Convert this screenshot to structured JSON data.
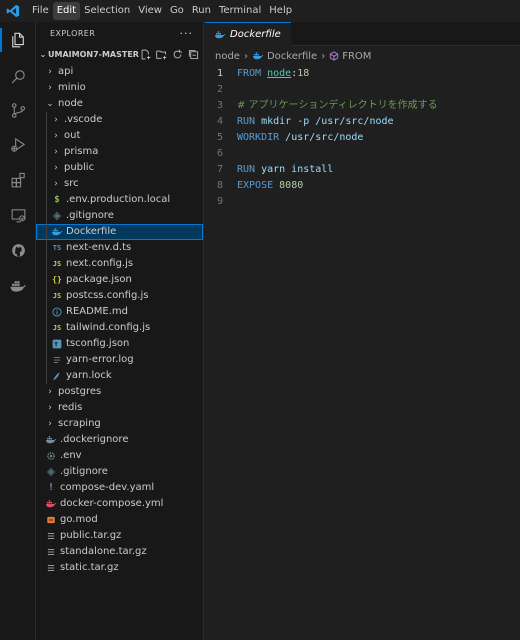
{
  "menu": [
    "File",
    "Edit",
    "Selection",
    "View",
    "Go",
    "Run",
    "Terminal",
    "Help"
  ],
  "activity_bar": [
    "files-icon",
    "search-icon",
    "source-control-icon",
    "run-debug-icon",
    "extensions-icon",
    "remote-explorer-icon",
    "github-icon",
    "docker-icon"
  ],
  "sidebar": {
    "title": "EXPLORER",
    "more": "···",
    "workspace": "UMAIMON7-MASTER",
    "tree": [
      {
        "label": "api",
        "kind": "folder",
        "depth": 1,
        "expanded": false
      },
      {
        "label": "minio",
        "kind": "folder",
        "depth": 1,
        "expanded": false
      },
      {
        "label": "node",
        "kind": "folder",
        "depth": 1,
        "expanded": true
      },
      {
        "label": ".vscode",
        "kind": "folder",
        "depth": 2,
        "expanded": false
      },
      {
        "label": "out",
        "kind": "folder",
        "depth": 2,
        "expanded": false
      },
      {
        "label": "prisma",
        "kind": "folder",
        "depth": 2,
        "expanded": false
      },
      {
        "label": "public",
        "kind": "folder",
        "depth": 2,
        "expanded": false
      },
      {
        "label": "src",
        "kind": "folder",
        "depth": 2,
        "expanded": false
      },
      {
        "label": ".env.production.local",
        "kind": "file",
        "icon": "dollar",
        "depth": 2
      },
      {
        "label": ".gitignore",
        "kind": "file",
        "icon": "git",
        "depth": 2
      },
      {
        "label": "Dockerfile",
        "kind": "file",
        "icon": "docker",
        "depth": 2,
        "selected": true
      },
      {
        "label": "next-env.d.ts",
        "kind": "file",
        "icon": "ts",
        "depth": 2
      },
      {
        "label": "next.config.js",
        "kind": "file",
        "icon": "js",
        "depth": 2
      },
      {
        "label": "package.json",
        "kind": "file",
        "icon": "json",
        "depth": 2
      },
      {
        "label": "postcss.config.js",
        "kind": "file",
        "icon": "js",
        "depth": 2
      },
      {
        "label": "README.md",
        "kind": "file",
        "icon": "info",
        "depth": 2
      },
      {
        "label": "tailwind.config.js",
        "kind": "file",
        "icon": "js",
        "depth": 2
      },
      {
        "label": "tsconfig.json",
        "kind": "file",
        "icon": "tsconfig",
        "depth": 2
      },
      {
        "label": "yarn-error.log",
        "kind": "file",
        "icon": "log",
        "depth": 2
      },
      {
        "label": "yarn.lock",
        "kind": "file",
        "icon": "yarn",
        "depth": 2
      },
      {
        "label": "postgres",
        "kind": "folder",
        "depth": 1,
        "expanded": false
      },
      {
        "label": "redis",
        "kind": "folder",
        "depth": 1,
        "expanded": false
      },
      {
        "label": "scraping",
        "kind": "folder",
        "depth": 1,
        "expanded": false
      },
      {
        "label": ".dockerignore",
        "kind": "file",
        "icon": "docker-gray",
        "depth": 1
      },
      {
        "label": ".env",
        "kind": "file",
        "icon": "gear",
        "depth": 1
      },
      {
        "label": ".gitignore",
        "kind": "file",
        "icon": "git",
        "depth": 1
      },
      {
        "label": "compose-dev.yaml",
        "kind": "file",
        "icon": "yaml",
        "depth": 1
      },
      {
        "label": "docker-compose.yml",
        "kind": "file",
        "icon": "docker-compose",
        "depth": 1
      },
      {
        "label": "go.mod",
        "kind": "file",
        "icon": "gomod",
        "depth": 1
      },
      {
        "label": "public.tar.gz",
        "kind": "file",
        "icon": "lines",
        "depth": 1
      },
      {
        "label": "standalone.tar.gz",
        "kind": "file",
        "icon": "lines",
        "depth": 1
      },
      {
        "label": "static.tar.gz",
        "kind": "file",
        "icon": "lines",
        "depth": 1
      }
    ]
  },
  "editor": {
    "tab_label": "Dockerfile",
    "breadcrumb": [
      "node",
      "Dockerfile",
      "FROM"
    ],
    "lines": [
      {
        "n": "1",
        "tokens": [
          {
            "t": "FROM",
            "c": "kw"
          },
          {
            "t": " "
          },
          {
            "t": "node",
            "c": "ident tok-u"
          },
          {
            "t": ":"
          },
          {
            "t": "18",
            "c": "num"
          }
        ]
      },
      {
        "n": "2",
        "tokens": []
      },
      {
        "n": "3",
        "tokens": [
          {
            "t": "# アプリケーションディレクトリを作成する",
            "c": "cmt"
          }
        ]
      },
      {
        "n": "4",
        "tokens": [
          {
            "t": "RUN",
            "c": "kw"
          },
          {
            "t": " mkdir -p /usr/src/node",
            "c": "path"
          }
        ]
      },
      {
        "n": "5",
        "tokens": [
          {
            "t": "WORKDIR",
            "c": "kw"
          },
          {
            "t": " /usr/src/node",
            "c": "path"
          }
        ]
      },
      {
        "n": "6",
        "tokens": []
      },
      {
        "n": "7",
        "tokens": [
          {
            "t": "RUN",
            "c": "kw"
          },
          {
            "t": " yarn install",
            "c": "path"
          }
        ]
      },
      {
        "n": "8",
        "tokens": [
          {
            "t": "EXPOSE",
            "c": "kw"
          },
          {
            "t": " "
          },
          {
            "t": "8080",
            "c": "num"
          }
        ]
      },
      {
        "n": "9",
        "tokens": []
      }
    ],
    "current_line": "1"
  },
  "colors": {
    "accent": "#0078d4",
    "keyword": "#569cd6",
    "comment": "#6a9955",
    "number": "#b5cea8"
  }
}
